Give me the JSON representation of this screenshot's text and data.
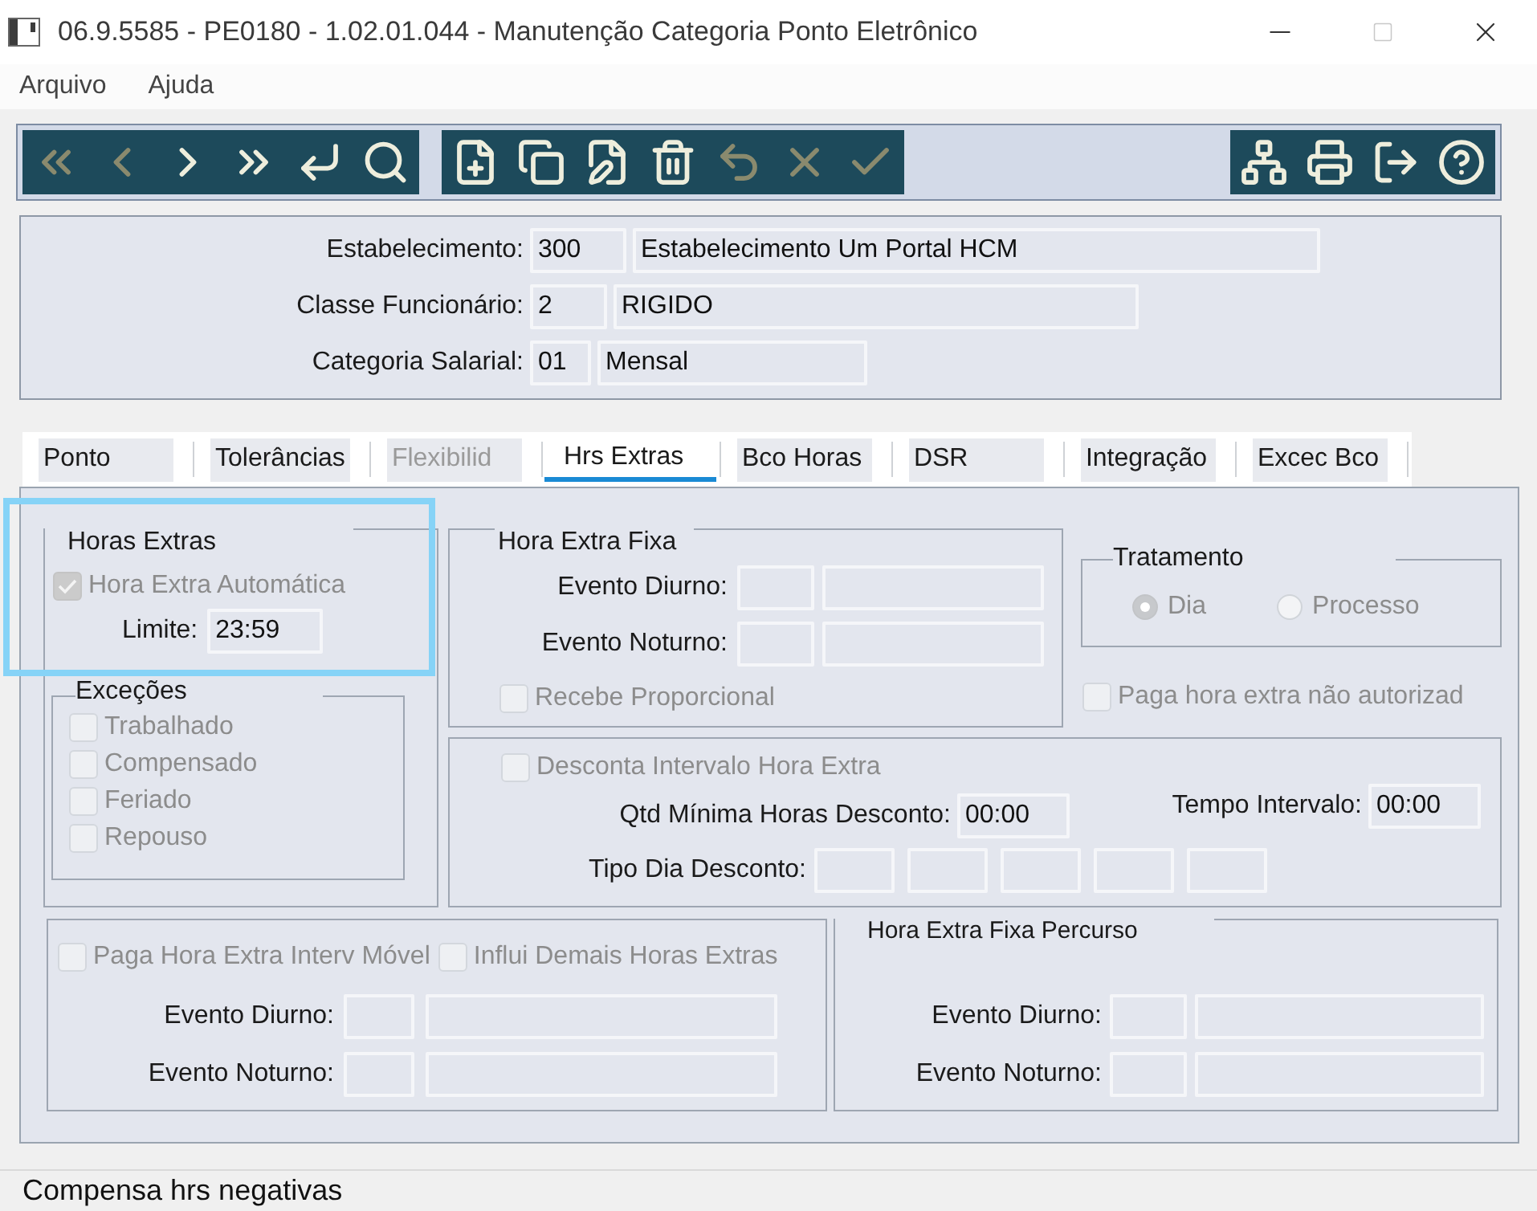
{
  "window": {
    "title": "06.9.5585 - PE0180 - 1.02.01.044 - Manutenção Categoria Ponto Eletrônico",
    "buttons": [
      {
        "kind": "minimize",
        "disabled": false
      },
      {
        "kind": "maximize",
        "disabled": true
      },
      {
        "kind": "close",
        "disabled": false
      }
    ]
  },
  "menu": [
    {
      "label": "Arquivo"
    },
    {
      "label": "Ajuda"
    }
  ],
  "toolbar": {
    "groups": [
      {
        "buttons": [
          {
            "kind": "first",
            "disabled": true
          },
          {
            "kind": "previous",
            "disabled": true
          },
          {
            "kind": "next",
            "disabled": false
          },
          {
            "kind": "last",
            "disabled": false
          },
          {
            "kind": "goto",
            "disabled": false
          },
          {
            "kind": "search",
            "disabled": false
          }
        ]
      },
      {
        "buttons": [
          {
            "kind": "new",
            "disabled": false
          },
          {
            "kind": "copy",
            "disabled": false
          },
          {
            "kind": "edit",
            "disabled": false
          },
          {
            "kind": "delete",
            "disabled": false
          },
          {
            "kind": "undo",
            "disabled": true
          },
          {
            "kind": "cancel",
            "disabled": true
          },
          {
            "kind": "save",
            "disabled": true
          }
        ]
      },
      {
        "buttons": [
          {
            "kind": "tree",
            "disabled": false
          },
          {
            "kind": "print",
            "disabled": false
          },
          {
            "kind": "exit",
            "disabled": false
          },
          {
            "kind": "help",
            "disabled": false
          }
        ]
      }
    ]
  },
  "header": {
    "fields": [
      {
        "label": "Estabelecimento:",
        "code": "300",
        "description": "Estabelecimento Um Portal HCM"
      },
      {
        "label": "Classe Funcionário:",
        "code": "2",
        "description": "RIGIDO"
      },
      {
        "label": "Categoria Salarial:",
        "code": "01",
        "description": "Mensal"
      }
    ]
  },
  "tabs": [
    {
      "label": "Ponto",
      "selected": false,
      "disabled": false
    },
    {
      "label": "Tolerâncias",
      "selected": false,
      "disabled": false
    },
    {
      "label": "Flexibilid",
      "selected": false,
      "disabled": true
    },
    {
      "label": "Hrs Extras",
      "selected": true,
      "disabled": false
    },
    {
      "label": "Bco Horas",
      "selected": false,
      "disabled": false
    },
    {
      "label": "DSR",
      "selected": false,
      "disabled": false
    },
    {
      "label": "Integração",
      "selected": false,
      "disabled": false
    },
    {
      "label": "Excec Bco",
      "selected": false,
      "disabled": false
    }
  ],
  "horas_extras": {
    "title": "Horas Extras",
    "highlighted": true,
    "automatic": {
      "label": "Hora Extra Automática",
      "checked": true,
      "disabled": true
    },
    "limit": {
      "label": "Limite:",
      "value": "23:59"
    },
    "exceptions": {
      "title": "Exceções",
      "items": [
        {
          "label": "Trabalhado",
          "checked": false,
          "disabled": true
        },
        {
          "label": "Compensado",
          "checked": false,
          "disabled": true
        },
        {
          "label": "Feriado",
          "checked": false,
          "disabled": true
        },
        {
          "label": "Repouso",
          "checked": false,
          "disabled": true
        }
      ]
    }
  },
  "hora_extra_fixa": {
    "title": "Hora Extra Fixa",
    "events": [
      {
        "label": "Evento Diurno:"
      },
      {
        "label": "Evento Noturno:"
      }
    ],
    "proportional": {
      "label": "Recebe Proporcional",
      "checked": false,
      "disabled": true
    }
  },
  "tratamento": {
    "title": "Tratamento",
    "options": [
      {
        "label": "Dia",
        "selected": true,
        "disabled": true
      },
      {
        "label": "Processo",
        "selected": false,
        "disabled": true
      }
    ]
  },
  "paga_nao_autorizada": {
    "label": "Paga hora extra não autorizad",
    "checked": false,
    "disabled": true
  },
  "desconto": {
    "toggle": {
      "label": "Desconta Intervalo Hora Extra",
      "checked": false,
      "disabled": true
    },
    "minimum": {
      "label": "Qtd Mínima Horas Desconto:",
      "value": "00:00"
    },
    "interval": {
      "label": "Tempo Intervalo:",
      "value": "00:00"
    },
    "day_type": {
      "label": "Tipo Dia Desconto:"
    }
  },
  "interv_movel": {
    "options": [
      {
        "label": "Paga Hora Extra Interv Móvel",
        "checked": false,
        "disabled": true
      },
      {
        "label": "Influi Demais Horas Extras",
        "checked": false,
        "disabled": true
      }
    ],
    "events": [
      {
        "label": "Evento Diurno:"
      },
      {
        "label": "Evento Noturno:"
      }
    ]
  },
  "percurso": {
    "title": "Hora Extra Fixa Percurso",
    "events": [
      {
        "label": "Evento Diurno:"
      },
      {
        "label": "Evento Noturno:"
      }
    ]
  },
  "status_bar": {
    "text": "Compensa hrs negativas"
  }
}
